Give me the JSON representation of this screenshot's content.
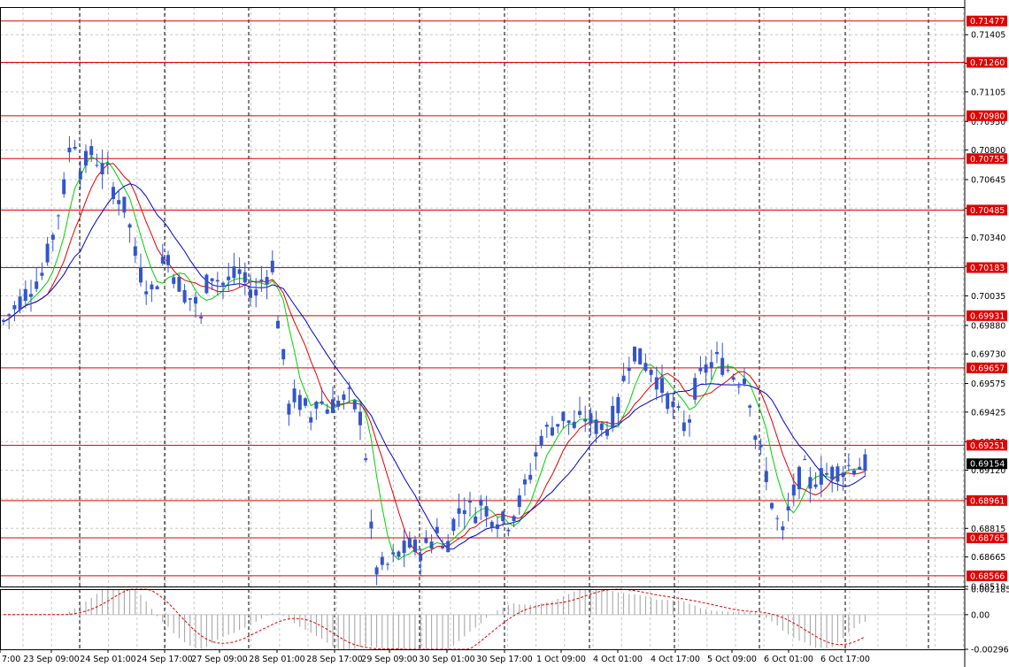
{
  "chart_data": [
    {
      "type": "candlestick",
      "panel": "price",
      "x_labels": [
        "7:00",
        "23 Sep 09:00",
        "24 Sep 01:00",
        "24 Sep 17:00",
        "27 Sep 09:00",
        "28 Sep 01:00",
        "28 Sep 17:00",
        "29 Sep 09:00",
        "30 Sep 01:00",
        "30 Sep 17:00",
        "1 Oct 09:00",
        "4 Oct 01:00",
        "4 Oct 17:00",
        "5 Oct 09:00",
        "6 Oct 01:00",
        "6 Oct 17:00"
      ],
      "y_ticks": [
        "0.71405",
        "0.71255",
        "0.71105",
        "0.70950",
        "0.70800",
        "0.70645",
        "0.70495",
        "0.70340",
        "0.70190",
        "0.70035",
        "0.69880",
        "0.69730",
        "0.69575",
        "0.69425",
        "0.69270",
        "0.69120",
        "0.68970",
        "0.68815",
        "0.68665",
        "0.68510"
      ],
      "ylim": [
        0.6851,
        0.7155
      ],
      "current_price": "0.69154",
      "levels": [
        "0.71477",
        "0.71260",
        "0.70980",
        "0.70755",
        "0.70485",
        "0.70183",
        "0.69931",
        "0.69657",
        "0.69251",
        "0.68961",
        "0.68765",
        "0.68566"
      ],
      "close_path": [
        [
          0,
          0.699
        ],
        [
          4,
          0.7005
        ],
        [
          7,
          0.7015
        ],
        [
          9,
          0.7035
        ],
        [
          11,
          0.706
        ],
        [
          12,
          0.708
        ],
        [
          13,
          0.7085
        ],
        [
          14,
          0.707
        ],
        [
          16,
          0.7078
        ],
        [
          17,
          0.7075
        ],
        [
          18,
          0.707
        ],
        [
          19,
          0.7068
        ],
        [
          20,
          0.706
        ],
        [
          22,
          0.705
        ],
        [
          23,
          0.704
        ],
        [
          24,
          0.7025
        ],
        [
          25,
          0.7015
        ],
        [
          26,
          0.701
        ],
        [
          27,
          0.7005
        ],
        [
          29,
          0.702
        ],
        [
          30,
          0.7025
        ],
        [
          31,
          0.7015
        ],
        [
          33,
          0.7005
        ],
        [
          35,
          0.7
        ],
        [
          36,
          0.699
        ],
        [
          37,
          0.701
        ],
        [
          38,
          0.7015
        ],
        [
          40,
          0.701
        ],
        [
          43,
          0.7015
        ],
        [
          44,
          0.701
        ],
        [
          46,
          0.7005
        ],
        [
          47,
          0.7012
        ],
        [
          48,
          0.7015
        ],
        [
          49,
          0.702
        ],
        [
          50,
          0.699
        ],
        [
          51,
          0.697
        ],
        [
          52,
          0.6945
        ],
        [
          53,
          0.695
        ],
        [
          55,
          0.6945
        ],
        [
          56,
          0.694
        ],
        [
          57,
          0.695
        ],
        [
          59,
          0.6945
        ],
        [
          61,
          0.6948
        ],
        [
          63,
          0.695
        ],
        [
          65,
          0.694
        ],
        [
          66,
          0.692
        ],
        [
          67,
          0.688
        ],
        [
          68,
          0.686
        ],
        [
          70,
          0.6862
        ],
        [
          72,
          0.6868
        ],
        [
          74,
          0.6872
        ],
        [
          76,
          0.687
        ],
        [
          78,
          0.6875
        ],
        [
          79,
          0.6882
        ],
        [
          80,
          0.687
        ],
        [
          81,
          0.6875
        ],
        [
          82,
          0.6885
        ],
        [
          84,
          0.6895
        ],
        [
          85,
          0.6892
        ],
        [
          86,
          0.689
        ],
        [
          87,
          0.6895
        ],
        [
          88,
          0.6892
        ],
        [
          89,
          0.6888
        ],
        [
          91,
          0.6885
        ],
        [
          92,
          0.6885
        ],
        [
          94,
          0.6895
        ],
        [
          96,
          0.691
        ],
        [
          98,
          0.693
        ],
        [
          100,
          0.6935
        ],
        [
          102,
          0.694
        ],
        [
          104,
          0.6935
        ],
        [
          106,
          0.694
        ],
        [
          108,
          0.6935
        ],
        [
          110,
          0.6935
        ],
        [
          112,
          0.6945
        ],
        [
          113,
          0.696
        ],
        [
          114,
          0.697
        ],
        [
          115,
          0.6975
        ],
        [
          116,
          0.697
        ],
        [
          118,
          0.6965
        ],
        [
          119,
          0.696
        ],
        [
          120,
          0.6955
        ],
        [
          122,
          0.6945
        ],
        [
          123,
          0.694
        ],
        [
          124,
          0.6935
        ],
        [
          125,
          0.694
        ],
        [
          126,
          0.6955
        ],
        [
          128,
          0.6965
        ],
        [
          129,
          0.6968
        ],
        [
          130,
          0.697
        ],
        [
          132,
          0.6965
        ],
        [
          134,
          0.696
        ],
        [
          135,
          0.6962
        ],
        [
          136,
          0.695
        ],
        [
          137,
          0.693
        ],
        [
          138,
          0.692
        ],
        [
          139,
          0.691
        ],
        [
          140,
          0.6895
        ],
        [
          141,
          0.6885
        ],
        [
          142,
          0.6878
        ],
        [
          143,
          0.689
        ],
        [
          144,
          0.69
        ],
        [
          145,
          0.6908
        ],
        [
          146,
          0.6912
        ],
        [
          147,
          0.6905
        ],
        [
          148,
          0.6908
        ],
        [
          150,
          0.691
        ],
        [
          152,
          0.6912
        ],
        [
          154,
          0.6914
        ],
        [
          156,
          0.6915
        ],
        [
          157,
          0.6915
        ]
      ],
      "series": [
        {
          "name": "",
          "color": "#00d000"
        },
        {
          "name": "",
          "color": "#e00000"
        },
        {
          "name": "",
          "color": "#0000cc"
        }
      ]
    },
    {
      "type": "bar",
      "panel": "oscillator",
      "y_ticks": [
        "0.002185",
        "0.00",
        "-0.002966"
      ],
      "ylim": [
        -0.002966,
        0.002185
      ]
    }
  ],
  "colors": {
    "candle": "#3355cc",
    "level": "#e00000",
    "grid": "#c8c8c8",
    "osc_histogram": "#a0a0a0",
    "osc_signal": "#e00000",
    "price_tag": "#000000"
  }
}
